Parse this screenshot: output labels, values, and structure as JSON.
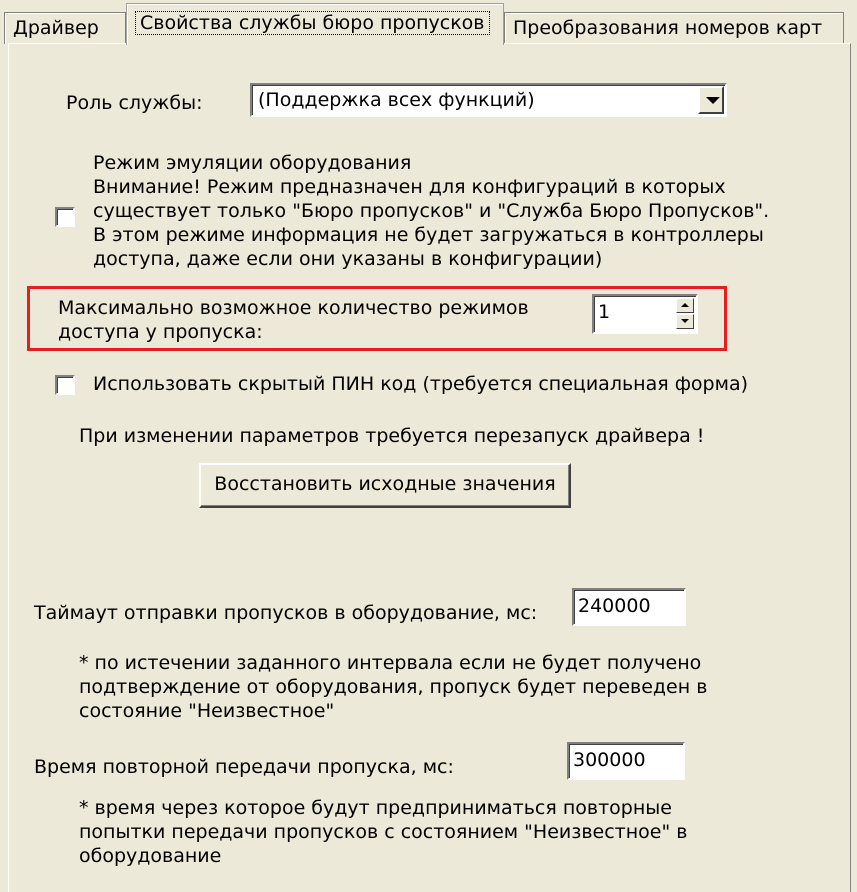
{
  "tabs": [
    {
      "label": "Драйвер"
    },
    {
      "label": "Свойства службы бюро пропусков"
    },
    {
      "label": "Преобразования номеров карт"
    }
  ],
  "role": {
    "label": "Роль службы:",
    "value": "(Поддержка всех функций)"
  },
  "emulation": {
    "lines": [
      "Режим эмуляции оборудования",
      "Внимание! Режим предназначен для конфигураций в которых",
      "существует только \"Бюро пропусков\" и \"Служба Бюро Пропусков\".",
      "В этом режиме информация не будет загружаться в контроллеры",
      "доступа, даже если они указаны в конфигурации)"
    ],
    "checked": false
  },
  "max_modes": {
    "line1": "Максимально возможное количество режимов",
    "line2": "доступа у пропуска:",
    "value": "1"
  },
  "hidden_pin": {
    "label": "Использовать скрытый ПИН код (требуется специальная форма)",
    "checked": false
  },
  "restart_note": "При изменении параметров требуется перезапуск драйвера !",
  "restore_button": "Восстановить исходные значения",
  "timeout": {
    "label": "Таймаут отправки пропусков в оборудование, мс:",
    "value": "240000",
    "note": [
      "* по истечении заданного интервала если не будет получено",
      "подтверждение от оборудования, пропуск будет переведен в",
      "состояние \"Неизвестное\""
    ]
  },
  "retry": {
    "label": "Время повторной передачи пропуска, мс:",
    "value": "300000",
    "note": [
      "* время через которое будут предприниматься повторные",
      "попытки передачи пропусков с состоянием \"Неизвестное\" в",
      "оборудование"
    ]
  },
  "colors": {
    "background": "#ece9d8",
    "highlight": "#e41f1f"
  }
}
